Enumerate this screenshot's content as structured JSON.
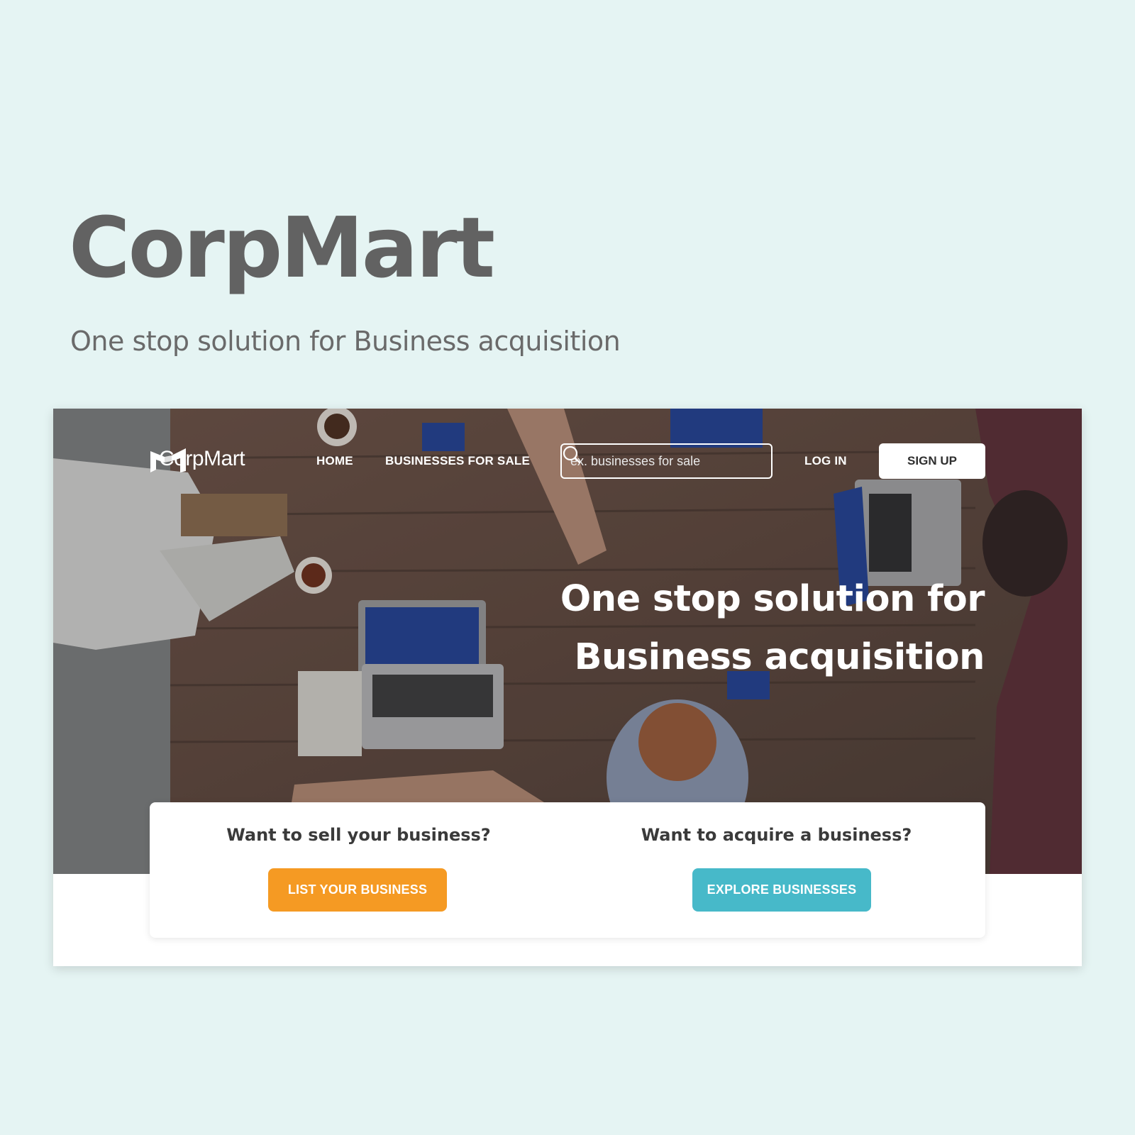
{
  "showcase": {
    "title": "CorpMart",
    "subtitle": "One stop solution for Business acquisition"
  },
  "navbar": {
    "logo_text": "CorpMart",
    "links": [
      {
        "label": "HOME"
      },
      {
        "label": "BUSINESSES FOR SALE"
      },
      {
        "label": "LOG IN"
      }
    ],
    "search": {
      "placeholder": "ex. businesses for sale",
      "value": ""
    },
    "signup_label": "SIGN UP"
  },
  "hero": {
    "headline_line1": "One stop solution for",
    "headline_line2": "Business acquisition"
  },
  "cta": {
    "sell": {
      "question": "Want to sell your business?",
      "button": "LIST YOUR BUSINESS"
    },
    "acquire": {
      "question": "Want to acquire a business?",
      "button": "EXPLORE BUSINESSES"
    }
  },
  "colors": {
    "background": "#e5f4f3",
    "orange": "#f59a23",
    "teal": "#47b9c9",
    "title_gray": "#626262"
  }
}
